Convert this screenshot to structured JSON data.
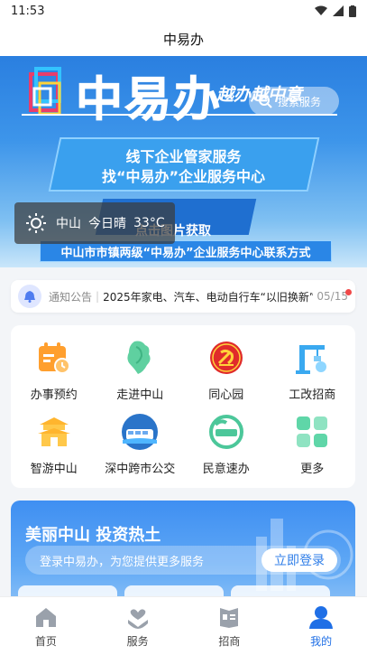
{
  "status_bar": {
    "time": "11:53"
  },
  "title_bar": {
    "title": "中易办"
  },
  "banner": {
    "brand": "中易办",
    "slogan": "越办越中意",
    "search_placeholder": "搜索服务",
    "line1": "线下企业管家服务",
    "line2": "找“中易办”企业服务中心",
    "click_hint": "点击图片获取",
    "contact": "中山市市镇两级“中易办”企业服务中心联系方式"
  },
  "weather": {
    "city": "中山",
    "condition": "今日晴",
    "temperature": "33°C",
    "icon": "sun-icon"
  },
  "notice": {
    "label": "通知公告",
    "separator": "|",
    "text": "2025年家电、汽车、电动自行车“以旧换新”",
    "date": "05/15"
  },
  "services": [
    {
      "label": "办事预约",
      "icon": "calendar-clock-icon"
    },
    {
      "label": "走进中山",
      "icon": "map-icon"
    },
    {
      "label": "同心园",
      "icon": "party-emblem-icon"
    },
    {
      "label": "工改招商",
      "icon": "crane-icon"
    },
    {
      "label": "智游中山",
      "icon": "gate-tower-icon"
    },
    {
      "label": "深中跨市公交",
      "icon": "bus-icon"
    },
    {
      "label": "民意速办",
      "icon": "hotline-12345-icon"
    },
    {
      "label": "更多",
      "icon": "grid-more-icon"
    }
  ],
  "promo": {
    "title": "美丽中山 投资热土",
    "login_text": "登录中易办，为您提供更多服务",
    "login_button": "立即登录"
  },
  "bottom_nav": [
    {
      "label": "首页",
      "icon": "home-icon",
      "active": false
    },
    {
      "label": "服务",
      "icon": "service-hands-icon",
      "active": false
    },
    {
      "label": "招商",
      "icon": "investment-book-icon",
      "active": false
    },
    {
      "label": "我的",
      "icon": "user-icon",
      "active": true
    }
  ],
  "colors": {
    "accent": "#1f6fe6",
    "banner": "#2a7fe0",
    "notice_dot": "#f04848"
  }
}
